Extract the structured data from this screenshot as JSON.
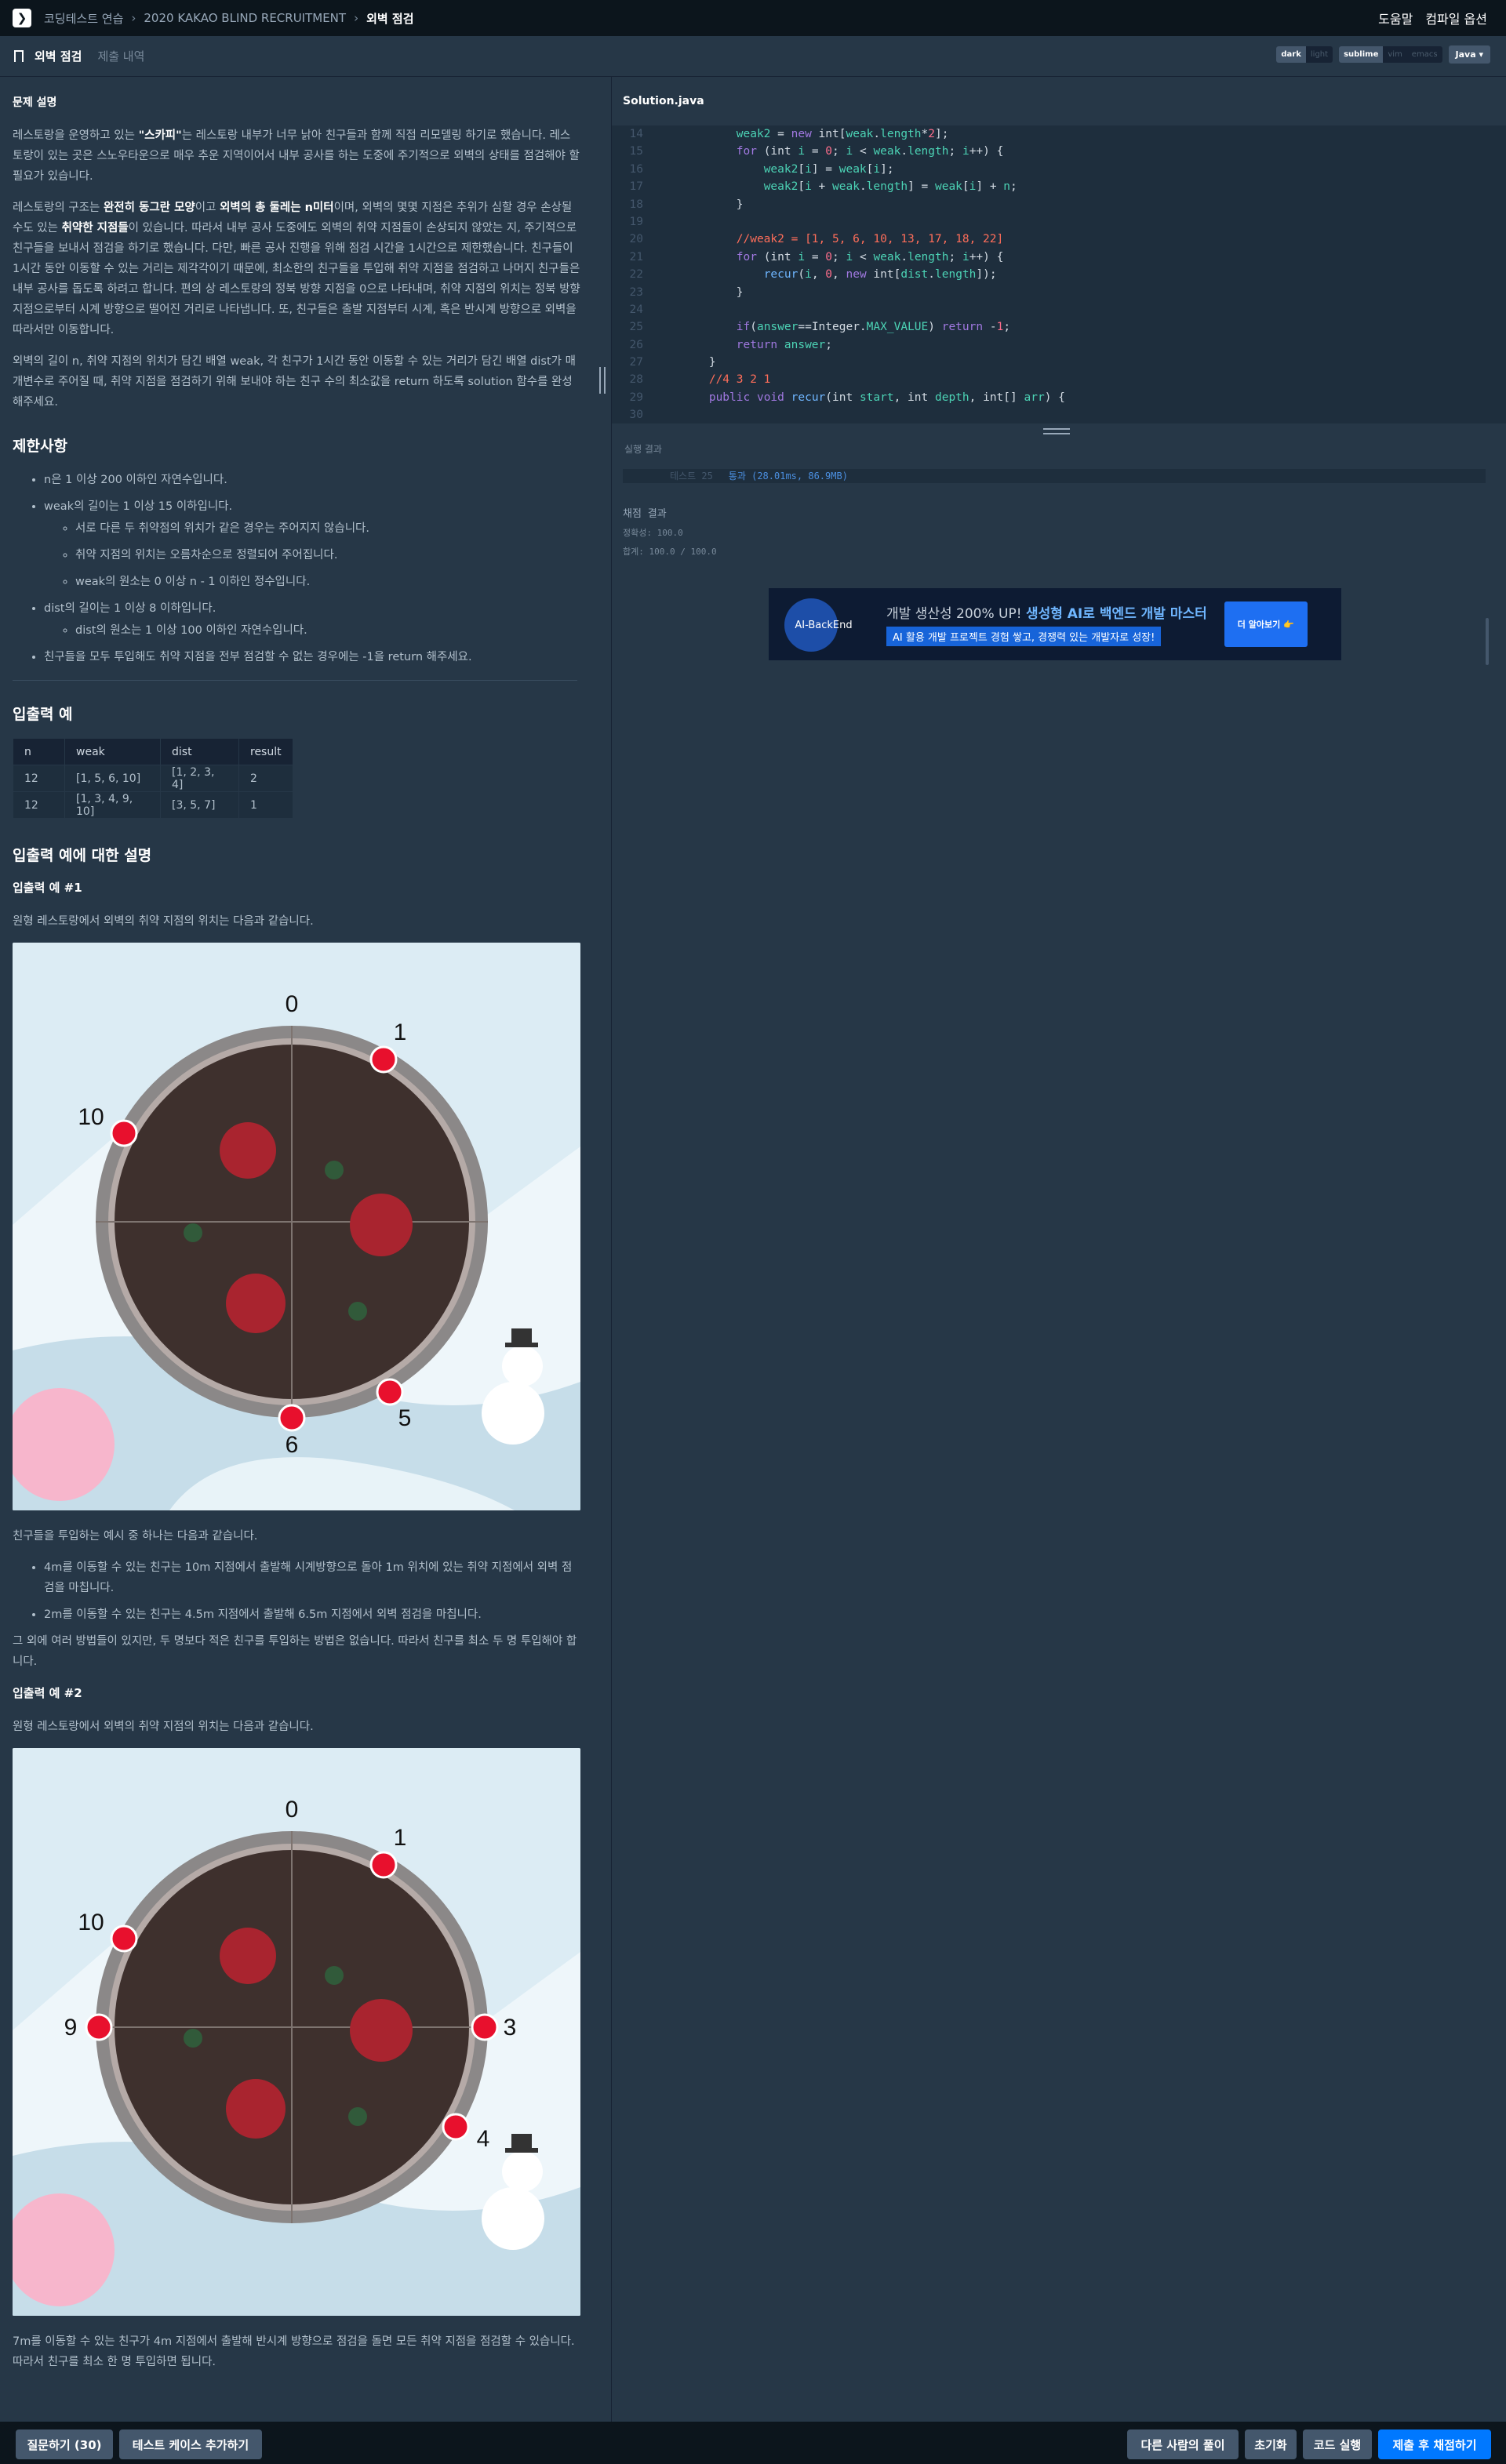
{
  "nav": {
    "crumbs": [
      "코딩테스트 연습",
      "2020 KAKAO BLIND RECRUITMENT",
      "외벽 점검"
    ],
    "help": "도움말",
    "compile_options": "컴파일 옵션"
  },
  "tabs": {
    "problem": "외벽 점검",
    "submissions": "제출 내역"
  },
  "themes": {
    "editor_dark": "dark",
    "editor_light": "light",
    "keymap": [
      "sublime",
      "vim",
      "emacs"
    ],
    "language": "Java ▾"
  },
  "problem": {
    "section_title": "문제 설명",
    "p1_a": "레스토랑을 운영하고 있는 ",
    "p1_b": "\"스카피\"",
    "p1_c": "는 레스토랑 내부가 너무 낡아 친구들과 함께 직접 리모델링 하기로 했습니다. 레스토랑이 있는 곳은 스노우타운으로 매우 추운 지역이어서 내부 공사를 하는 도중에 주기적으로 외벽의 상태를 점검해야 할 필요가 있습니다.",
    "p2_a": "레스토랑의 구조는 ",
    "p2_b": "완전히 동그란 모양",
    "p2_c": "이고 ",
    "p2_d": "외벽의 총 둘레는 n미터",
    "p2_e": "이며, 외벽의 몇몇 지점은 추위가 심할 경우 손상될 수도 있는 ",
    "p2_f": "취약한 지점들",
    "p2_g": "이 있습니다. 따라서 내부 공사 도중에도 외벽의 취약 지점들이 손상되지 않았는 지, 주기적으로 친구들을 보내서 점검을 하기로 했습니다. 다만, 빠른 공사 진행을 위해 점검 시간을 1시간으로 제한했습니다. 친구들이 1시간 동안 이동할 수 있는 거리는 제각각이기 때문에, 최소한의 친구들을 투입해 취약 지점을 점검하고 나머지 친구들은 내부 공사를 돕도록 하려고 합니다. 편의 상 레스토랑의 정북 방향 지점을 0으로 나타내며, 취약 지점의 위치는 정북 방향 지점으로부터 시계 방향으로 떨어진 거리로 나타냅니다. 또, 친구들은 출발 지점부터 시계, 혹은 반시계 방향으로 외벽을 따라서만 이동합니다.",
    "p3": "외벽의 길이 n, 취약 지점의 위치가 담긴 배열 weak, 각 친구가 1시간 동안 이동할 수 있는 거리가 담긴 배열 dist가 매개변수로 주어질 때, 취약 지점을 점검하기 위해 보내야 하는 친구 수의 최소값을 return 하도록 solution 함수를 완성해주세요.",
    "limits_title": "제한사항",
    "limits": [
      "n은 1 이상 200 이하인 자연수입니다.",
      "weak의 길이는 1 이상 15 이하입니다.",
      "dist의 길이는 1 이상 8 이하입니다.",
      "친구들을 모두 투입해도 취약 지점을 전부 점검할 수 없는 경우에는 -1을 return 해주세요."
    ],
    "weak_sub": [
      "서로 다른 두 취약점의 위치가 같은 경우는 주어지지 않습니다.",
      "취약 지점의 위치는 오름차순으로 정렬되어 주어집니다.",
      "weak의 원소는 0 이상 n - 1 이하인 정수입니다."
    ],
    "dist_sub": [
      "dist의 원소는 1 이상 100 이하인 자연수입니다."
    ],
    "io_title": "입출력 예",
    "io_headers": [
      "n",
      "weak",
      "dist",
      "result"
    ],
    "io_rows": [
      [
        "12",
        "[1, 5, 6, 10]",
        "[1, 2, 3, 4]",
        "2"
      ],
      [
        "12",
        "[1, 3, 4, 9, 10]",
        "[3, 5, 7]",
        "1"
      ]
    ],
    "explain_title": "입출력 예에 대한 설명",
    "ex1_title": "입출력 예 #1",
    "ex1_intro": "원형 레스토랑에서 외벽의 취약 지점의 위치는 다음과 같습니다.",
    "ex1_labels": [
      "0",
      "1",
      "10",
      "5",
      "6"
    ],
    "ex1_after": "친구들을 투입하는 예시 중 하나는 다음과 같습니다.",
    "ex1_bullets": [
      "4m를 이동할 수 있는 친구는 10m 지점에서 출발해 시계방향으로 돌아 1m 위치에 있는 취약 지점에서 외벽 점검을 마칩니다.",
      "2m를 이동할 수 있는 친구는 4.5m 지점에서 출발해 6.5m 지점에서 외벽 점검을 마칩니다."
    ],
    "ex1_end": "그 외에 여러 방법들이 있지만, 두 명보다 적은 친구를 투입하는 방법은 없습니다. 따라서 친구를 최소 두 명 투입해야 합니다.",
    "ex2_title": "입출력 예 #2",
    "ex2_intro": "원형 레스토랑에서 외벽의 취약 지점의 위치는 다음과 같습니다.",
    "ex2_labels": [
      "0",
      "1",
      "10",
      "9",
      "3",
      "4"
    ],
    "ex2_end": "7m를 이동할 수 있는 친구가 4m 지점에서 출발해 반시계 방향으로 점검을 돌면 모든 취약 지점을 점검할 수 있습니다. 따라서 친구를 최소 한 명 투입하면 됩니다."
  },
  "editor": {
    "filename": "Solution.java",
    "line_numbers": [
      "14",
      "15",
      "16",
      "17",
      "18",
      "19",
      "20",
      "21",
      "22",
      "23",
      "24",
      "25",
      "26",
      "27",
      "28",
      "29",
      "30"
    ],
    "output_label": "실행 결과",
    "output_line_label": "테스트 25",
    "output_line_pass": "통과 (28.01ms, 86.9MB)",
    "grade_title": "채점 결과",
    "grade_accuracy": "정확성: 100.0",
    "grade_total": "합계: 100.0 / 100.0"
  },
  "ad": {
    "logo_text": "AI-BackEnd",
    "headline_a": "개발 생산성 200% UP! ",
    "headline_b": "생성형 AI로 백엔드 개발 마스터",
    "sub": "AI 활용 개발 프로젝트 경험 쌓고, 경쟁력 있는 개발자로 성장!",
    "button": "더 알아보기 👉"
  },
  "bottom": {
    "ask": "질문하기 (30)",
    "add_testcase": "테스트 케이스 추가하기",
    "others": "다른 사람의 풀이",
    "reset": "초기화",
    "run": "코드 실행",
    "submit": "제출 후 채점하기"
  },
  "colors": {
    "accent": "#0078ff",
    "weak_point": "#e8102d",
    "bg": "#263747"
  }
}
